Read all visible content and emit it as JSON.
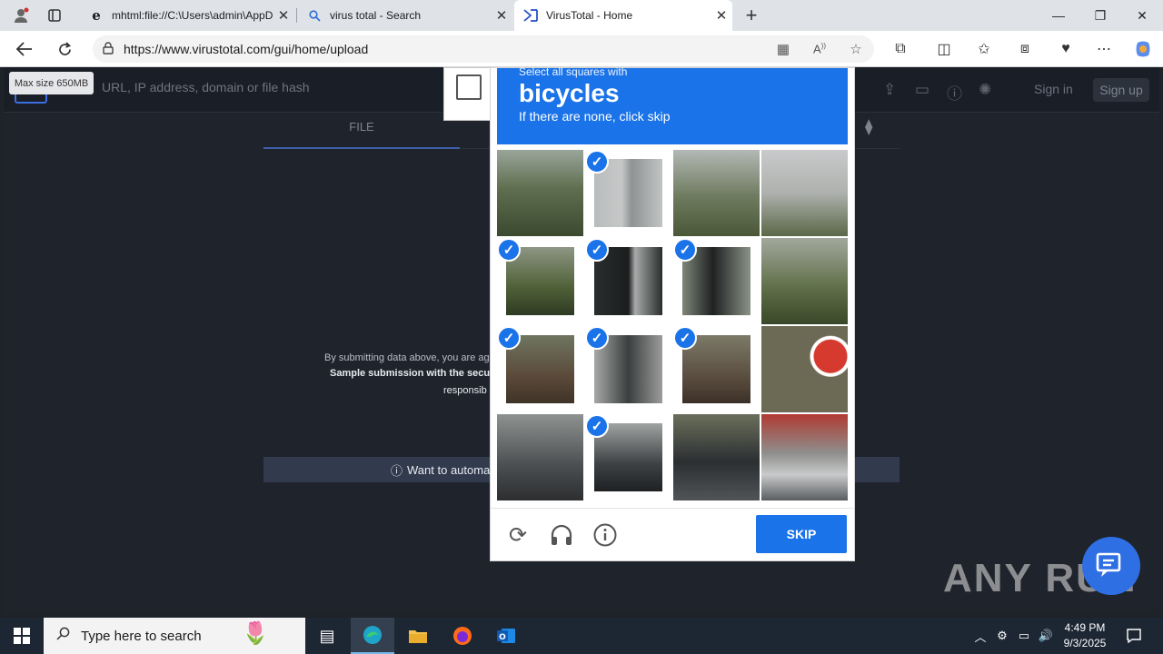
{
  "browser": {
    "tabs": [
      {
        "label": "mhtml:file://C:\\Users\\admin\\AppD",
        "icon": "ie-icon"
      },
      {
        "label": "virus total - Search",
        "icon": "search-icon"
      },
      {
        "label": "VirusTotal - Home",
        "icon": "virustotal-icon"
      }
    ],
    "new_tab": "+",
    "url": "https://www.virustotal.com/gui/home/upload"
  },
  "page": {
    "search_placeholder": "URL, IP address, domain or file hash",
    "tooltip": "Max size 650MB",
    "sign_in": "Sign in",
    "sign_up": "Sign up",
    "tab_file": "FILE",
    "terms_line1": "By submitting data above, you are ag",
    "terms_line2": "Sample submission with the secu",
    "terms_line3": "responsib",
    "automate": "Want to automa"
  },
  "captcha": {
    "instruction_small": "Select all squares with",
    "target": "bicycles",
    "subtitle": "If there are none, click skip",
    "skip_label": "SKIP",
    "selected_cells": [
      1,
      4,
      5,
      6,
      8,
      9,
      10,
      13
    ]
  },
  "watermark": "ANY RUN",
  "taskbar": {
    "search_placeholder": "Type here to search",
    "time": "4:49 PM",
    "date": "9/3/2025"
  },
  "colors": {
    "accent": "#1a73e8",
    "page_bg": "#1f232b"
  }
}
